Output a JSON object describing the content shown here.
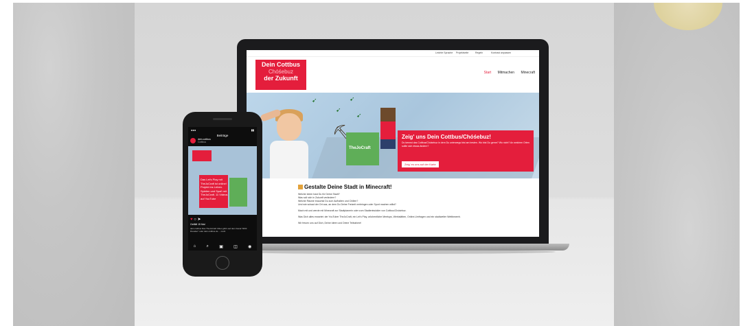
{
  "logo": {
    "line1": "Dein Cottbus",
    "line2": "Chóśebuz",
    "line3": "der Zukunft"
  },
  "topbar": {
    "links": [
      "Leichte Sprache",
      "Projektseite",
      "Regeln",
      "Kontrast anpassen"
    ]
  },
  "nav": {
    "items": [
      "Start",
      "Mitmachen",
      "Minecraft"
    ]
  },
  "hero": {
    "craft_label": "TheJoCraft",
    "cta_heading": "Zeig' uns Dein Cottbus/Chóśebuz!",
    "cta_text": "Du kennst das Cottbus/Chóśebuz in dem Du unterwegs bist am besten. Wo bist Du gerne? Wo nicht? An welchen Orten sollte sich etwas ändern?",
    "cta_button": "Zeig' es uns auf der Karte"
  },
  "content": {
    "title": "Gestalte Deine Stadt in Minecraft!",
    "lines": [
      "Welche Ideen hast Du für Deine Stadt?",
      "Was soll sich in Zukunft verändern?",
      "Welche Räume brauchst Du zum Aufhalten und Chillen?",
      "Und wie schaut der Ort aus, an dem Du Deine Freizeit verbringen oder Sport machen willst?",
      "Mach mit und werde mit Minecraft zur Stadtplanerin oder zum Stadtentwickler von Cottbus/Chóśebuz.",
      "Was Dich alles erwartet: der YouTuber TheJoCraft, ein Let's Play, wöchentliche Meetups, Werkstätten, Online-Umfragen und ein stadtweiter Wettbewerb.",
      "Wir freuen uns auf Dich, Deine Ideen und Deine Teilnahme!"
    ]
  },
  "phone": {
    "header_title": "Beiträge",
    "account_name": "dein.cottbus",
    "account_sub": "Cottbus",
    "post_text": "Das Let's Play mit TheJoCraft ist online! Projekt ins Leben. Spielen und Spaß mit TheJoCraft. 11 Videos auf YouTube",
    "likes": "Gefällt 15 Mal",
    "caption": "dein.cottbus Das TheJoCraft Video gibt's auf dem Kanal \"RDK Dresden\" oder dein.cottbus.de ... mehr"
  },
  "colors": {
    "brand_red": "#e41e3c",
    "minecraft_green": "#5fae58"
  }
}
